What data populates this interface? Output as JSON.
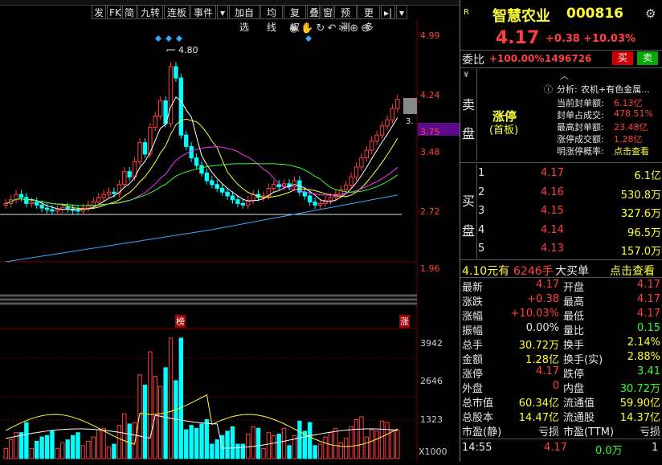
{
  "toolbar": {
    "buttons": [
      "发",
      "FK",
      "简",
      "九转",
      "连板",
      "事件",
      "▾",
      "加自选",
      "均线",
      "复权",
      "叠",
      "窗",
      "预测",
      "更多",
      "▸|",
      "▾"
    ]
  },
  "price_axis": [
    "4.99",
    "4.24",
    "3.75",
    "3.48",
    "2.72",
    "1.96"
  ],
  "current_price_tag": "3.75",
  "peak_label": "4.80",
  "side_mark": "3.",
  "volume_axis": [
    "3942",
    "2646",
    "1323",
    "X1000"
  ],
  "markers": {
    "bang": "榜",
    "zhang": "涨"
  },
  "stock": {
    "badge": "R",
    "name": "智慧农业",
    "code": "000816",
    "price": "4.17",
    "change": "+0.38",
    "change_pct": "+10.03%"
  },
  "weibi": {
    "label": "委比",
    "value": "+100.00%",
    "amount": "1496726",
    "sell_btn": "买",
    "buy_btn": "卖"
  },
  "sell_side": {
    "label_top": "卖",
    "label_bottom": "盘",
    "status": "涨停",
    "status_sub": "(首板)",
    "analysis_label": "分析:",
    "analysis_value": "农机+有色金属...",
    "lines": [
      {
        "label": "当前封单额:",
        "value": "6.13亿"
      },
      {
        "label": "封单占成交:",
        "value": "478.51%"
      },
      {
        "label": "最高封单额:",
        "value": "23.48亿"
      },
      {
        "label": "涨停成交额:",
        "value": "1.28亿"
      },
      {
        "label": "明涨停概率:",
        "value": "点击查看"
      }
    ]
  },
  "buy_side": {
    "label_top": "买",
    "label_bottom": "盘",
    "levels": [
      {
        "n": "1",
        "price": "4.17",
        "vol": "6.1亿"
      },
      {
        "n": "2",
        "price": "4.16",
        "vol": "530.8万"
      },
      {
        "n": "3",
        "price": "4.15",
        "vol": "327.6万"
      },
      {
        "n": "4",
        "price": "4.14",
        "vol": "96.5万"
      },
      {
        "n": "5",
        "price": "4.13",
        "vol": "157.0万"
      }
    ]
  },
  "big_order": {
    "price": "4.10元有",
    "hands": "6246手",
    "label": "大买单",
    "link": "点击查看"
  },
  "quote": [
    {
      "l1": "最新",
      "v1": "4.17",
      "l2": "开盘",
      "v2": "4.17"
    },
    {
      "l1": "涨跌",
      "v1": "+0.38",
      "l2": "最高",
      "v2": "4.17"
    },
    {
      "l1": "涨幅",
      "v1": "+10.03%",
      "l2": "最低",
      "v2": "4.17"
    },
    {
      "l1": "振幅",
      "v1": "0.00%",
      "l2": "量比",
      "v2": "0.15"
    },
    {
      "l1": "总手",
      "v1": "30.72万",
      "l2": "换手",
      "v2": "2.14%"
    },
    {
      "l1": "金额",
      "v1": "1.28亿",
      "l2": "换手(实)",
      "v2": "2.88%"
    },
    {
      "l1": "涨停",
      "v1": "4.17",
      "l2": "跌停",
      "v2": "3.41"
    },
    {
      "l1": "外盘",
      "v1": "0",
      "l2": "内盘",
      "v2": "30.72万"
    },
    {
      "l1": "总市值",
      "v1": "60.34亿",
      "l2": "流通值",
      "v2": "59.90亿"
    },
    {
      "l1": "总股本",
      "v1": "14.47亿",
      "l2": "流通股",
      "v2": "14.37亿"
    },
    {
      "l1": "市盈(静)",
      "v1": "亏损",
      "l2": "市盈(TTM)",
      "v2": "亏损"
    }
  ],
  "tick": {
    "time": "14:55",
    "price": "4.17",
    "vol": "0.0万",
    "n": "1"
  },
  "colors": {
    "up": "#ff4040",
    "down": "#00ffff",
    "bg": "#000000",
    "grid": "#800000"
  }
}
